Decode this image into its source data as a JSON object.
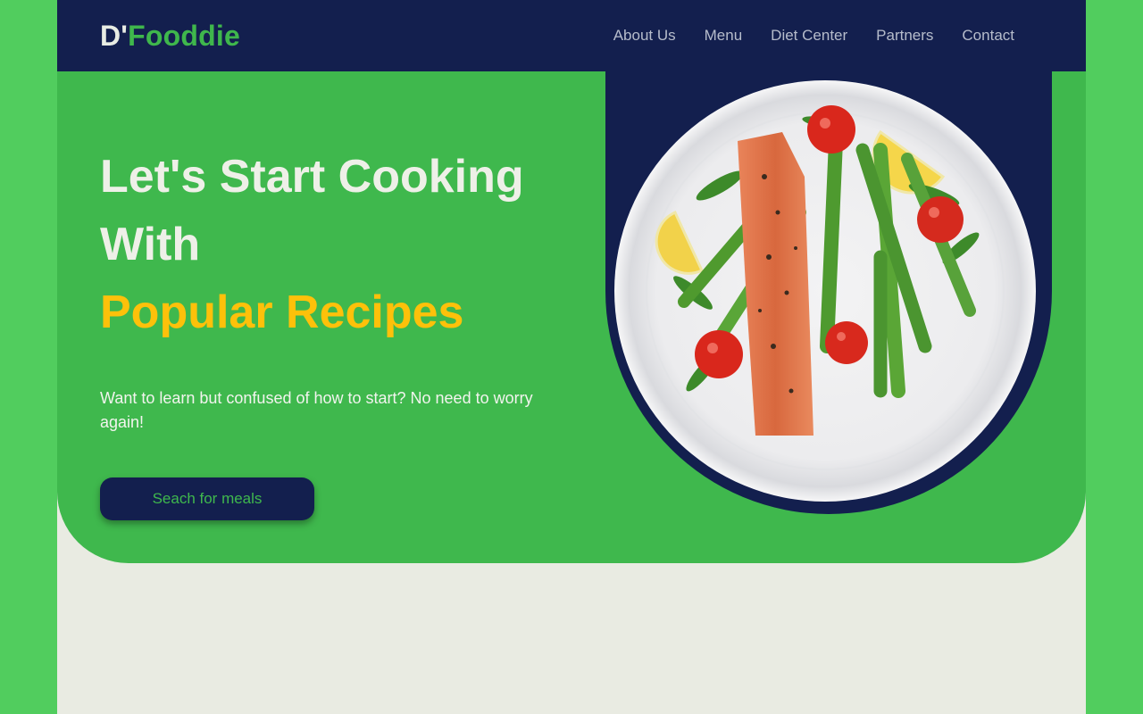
{
  "header": {
    "logo_prefix": "D'",
    "logo_brand": "Fooddie",
    "nav": [
      {
        "label": "About Us"
      },
      {
        "label": "Menu"
      },
      {
        "label": "Diet Center"
      },
      {
        "label": "Partners"
      },
      {
        "label": "Contact"
      }
    ]
  },
  "hero": {
    "headline_line1": "Let's Start Cooking",
    "headline_line2": "With",
    "headline_accent": "Popular Recipes",
    "subtext": "Want to learn but confused of how to start? No need to worry again!",
    "cta_label": "Seach for meals",
    "image_icon": "salmon-asparagus-plate-icon"
  },
  "colors": {
    "outer_background": "#51cd5e",
    "page_background": "#e9ebe2",
    "navy": "#131f4e",
    "green": "#3fb84d",
    "accent_yellow": "#fdc10a",
    "light_text": "#eef0e8"
  }
}
